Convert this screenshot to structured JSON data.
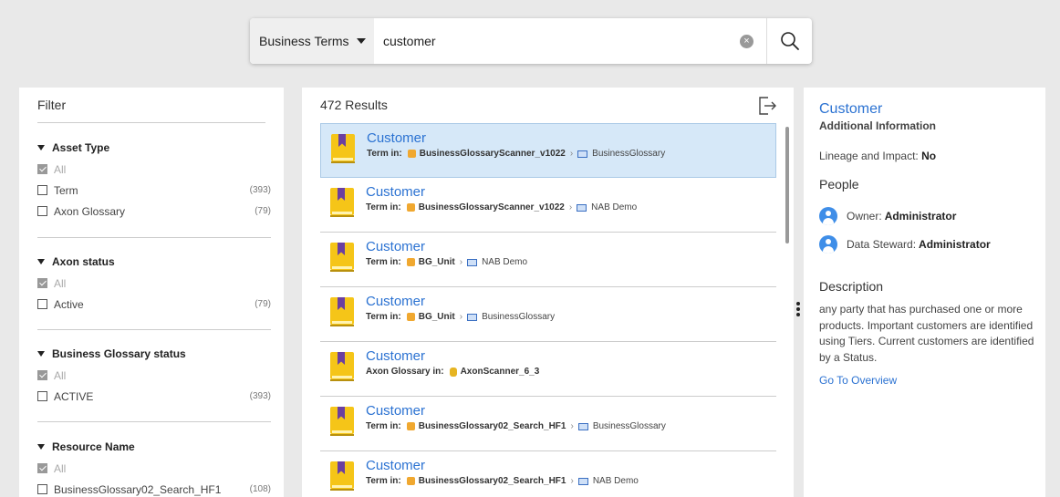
{
  "search": {
    "scope_label": "Business Terms",
    "query": "customer"
  },
  "filter": {
    "title": "Filter",
    "groups": [
      {
        "title": "Asset Type",
        "options": [
          {
            "label": "All",
            "count": "",
            "checked": true
          },
          {
            "label": "Term",
            "count": "(393)",
            "checked": false
          },
          {
            "label": "Axon Glossary",
            "count": "(79)",
            "checked": false
          }
        ]
      },
      {
        "title": "Axon status",
        "options": [
          {
            "label": "All",
            "count": "",
            "checked": true
          },
          {
            "label": "Active",
            "count": "(79)",
            "checked": false
          }
        ]
      },
      {
        "title": "Business Glossary status",
        "options": [
          {
            "label": "All",
            "count": "",
            "checked": true
          },
          {
            "label": "ACTIVE",
            "count": "(393)",
            "checked": false
          }
        ]
      },
      {
        "title": "Resource Name",
        "options": [
          {
            "label": "All",
            "count": "",
            "checked": true
          },
          {
            "label": "BusinessGlossary02_Search_HF1",
            "count": "(108)",
            "checked": false
          }
        ]
      }
    ]
  },
  "results": {
    "count_label": "472 Results",
    "items": [
      {
        "title": "Customer",
        "location_label": "Term in:",
        "resource": "BusinessGlossaryScanner_v1022",
        "glossary": "BusinessGlossary",
        "resource_icon": "package-icon"
      },
      {
        "title": "Customer",
        "location_label": "Term in:",
        "resource": "BusinessGlossaryScanner_v1022",
        "glossary": "NAB Demo",
        "resource_icon": "package-icon"
      },
      {
        "title": "Customer",
        "location_label": "Term in:",
        "resource": "BG_Unit",
        "glossary": "NAB Demo",
        "resource_icon": "package-icon"
      },
      {
        "title": "Customer",
        "location_label": "Term in:",
        "resource": "BG_Unit",
        "glossary": "BusinessGlossary",
        "resource_icon": "package-icon"
      },
      {
        "title": "Customer",
        "location_label": "Axon Glossary in:",
        "resource": "AxonScanner_6_3",
        "glossary": "",
        "resource_icon": "database-icon"
      },
      {
        "title": "Customer",
        "location_label": "Term in:",
        "resource": "BusinessGlossary02_Search_HF1",
        "glossary": "BusinessGlossary",
        "resource_icon": "package-icon"
      },
      {
        "title": "Customer",
        "location_label": "Term in:",
        "resource": "BusinessGlossary02_Search_HF1",
        "glossary": "NAB Demo",
        "resource_icon": "package-icon"
      }
    ]
  },
  "detail": {
    "title": "Customer",
    "subtitle": "Additional Information",
    "lineage_label": "Lineage and Impact:",
    "lineage_value": "No",
    "people_heading": "People",
    "owner_label": "Owner:",
    "owner_value": "Administrator",
    "steward_label": "Data Steward:",
    "steward_value": "Administrator",
    "description_heading": "Description",
    "description": "any party that has purchased one or more products. Important customers are identified using Tiers. Current customers are identified by a Status.",
    "overview_link": "Go To Overview"
  },
  "colors": {
    "accent": "#2b72d2",
    "selected_row": "#d6e8f8",
    "term_icon_yellow": "#f5c518",
    "term_icon_purple": "#6b3fa0"
  }
}
